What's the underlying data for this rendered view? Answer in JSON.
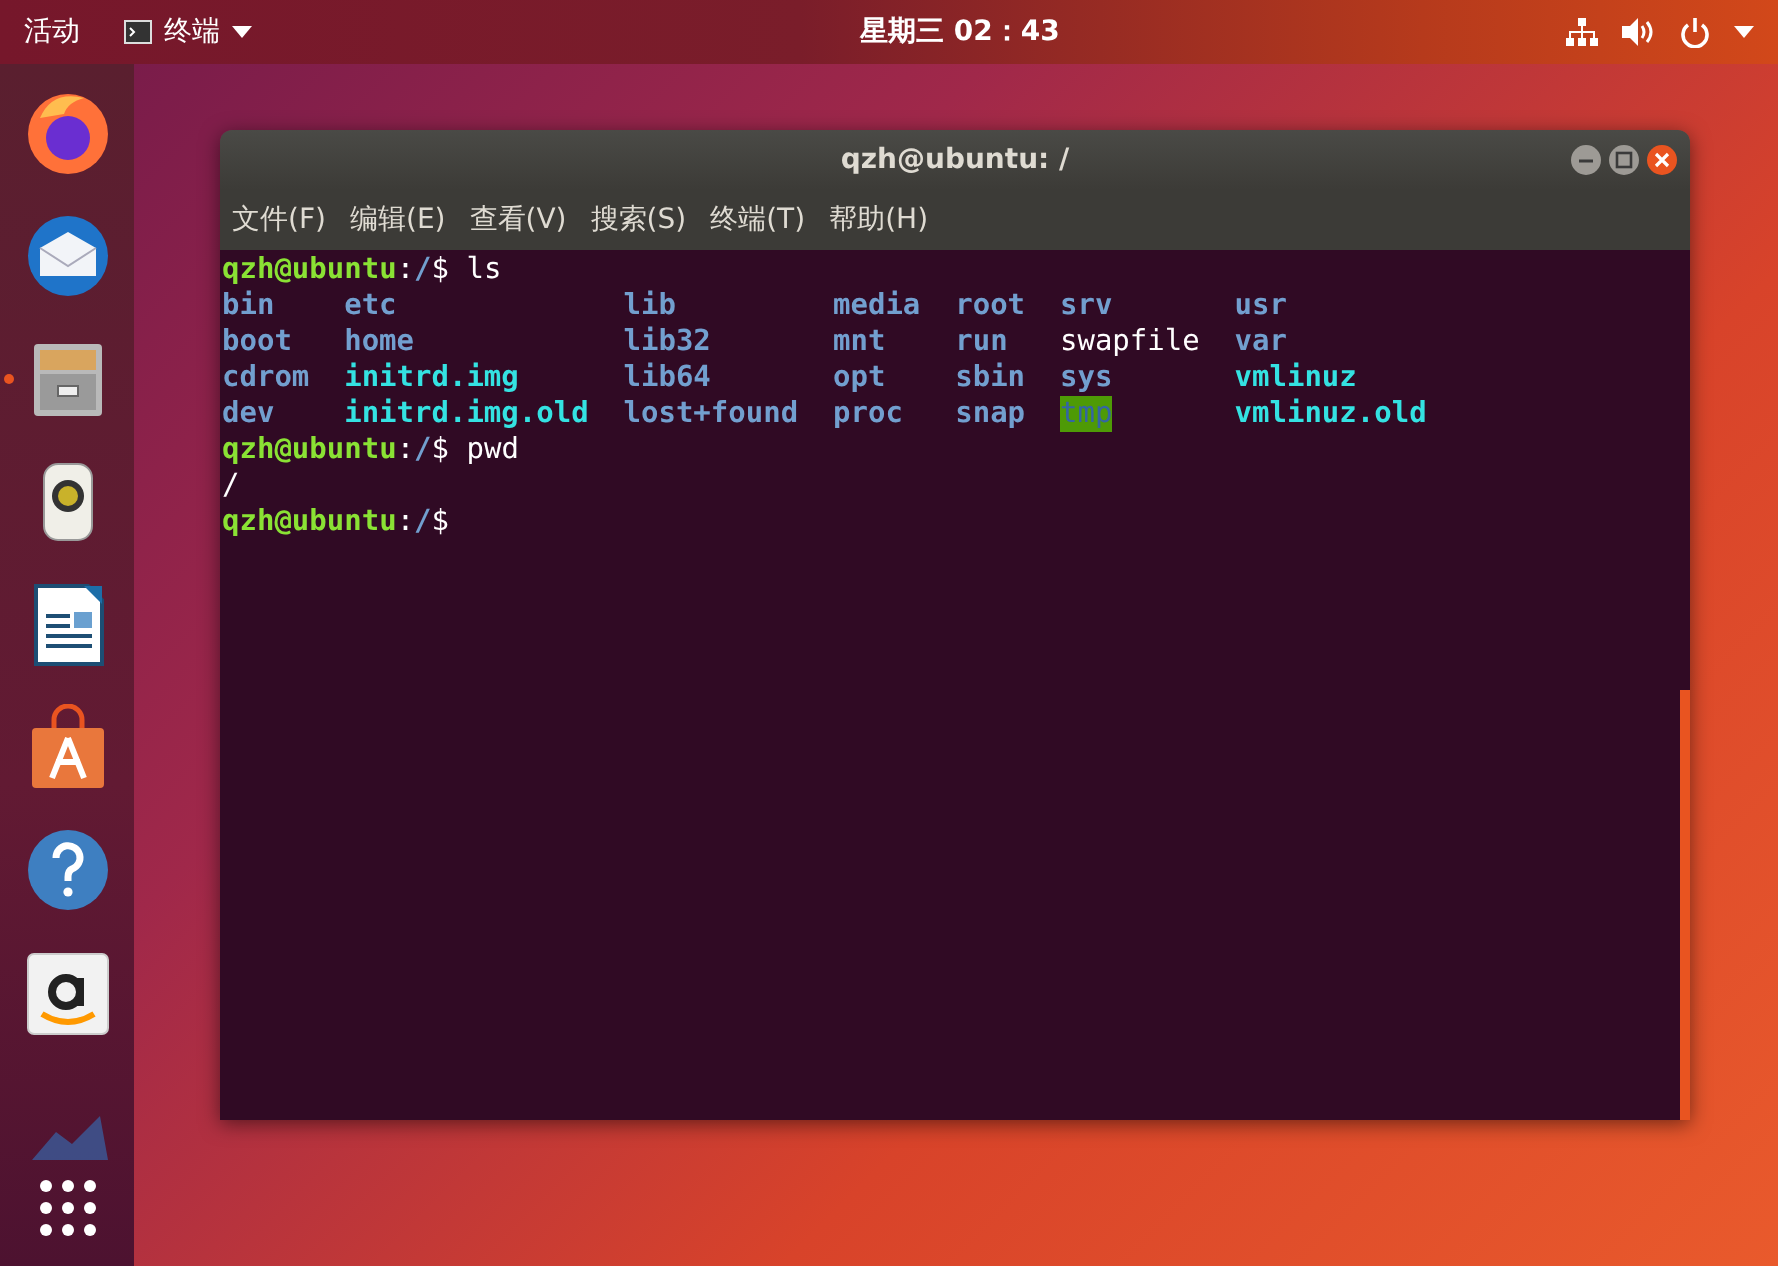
{
  "top_bar": {
    "activities": "活动",
    "app_menu": "终端",
    "clock": "星期三 02：43"
  },
  "dock": {
    "items": [
      {
        "kind": "firefox",
        "running": false
      },
      {
        "kind": "mail",
        "running": false
      },
      {
        "kind": "files",
        "running": true
      },
      {
        "kind": "speaker",
        "running": false
      },
      {
        "kind": "writer",
        "running": false
      },
      {
        "kind": "store",
        "running": false
      },
      {
        "kind": "help",
        "running": false
      },
      {
        "kind": "amazon",
        "running": false
      },
      {
        "kind": "partial",
        "running": false
      }
    ]
  },
  "terminal": {
    "title": "qzh@ubuntu: /",
    "menu": [
      "文件(F)",
      "编辑(E)",
      "查看(V)",
      "搜索(S)",
      "终端(T)",
      "帮助(H)"
    ],
    "lines": [
      {
        "kind": "prompt",
        "user_host": "qzh@ubuntu",
        "colon": ":",
        "path": "/",
        "command": "$ ls"
      },
      {
        "kind": "listing",
        "entries": [
          {
            "text": "bin",
            "kind": "dir"
          },
          {
            "text": "etc",
            "kind": "dir"
          },
          {
            "text": "lib",
            "kind": "dir"
          },
          {
            "text": "media",
            "kind": "dir"
          },
          {
            "text": "root",
            "kind": "dir"
          },
          {
            "text": "srv",
            "kind": "dir"
          },
          {
            "text": "usr",
            "kind": "dir"
          },
          {
            "text": "boot",
            "kind": "dir"
          },
          {
            "text": "home",
            "kind": "dir"
          },
          {
            "text": "lib32",
            "kind": "dir"
          },
          {
            "text": "mnt",
            "kind": "dir"
          },
          {
            "text": "run",
            "kind": "dir"
          },
          {
            "text": "swapfile",
            "kind": "file"
          },
          {
            "text": "var",
            "kind": "dir"
          },
          {
            "text": "cdrom",
            "kind": "dir"
          },
          {
            "text": "initrd.img",
            "kind": "link"
          },
          {
            "text": "lib64",
            "kind": "dir"
          },
          {
            "text": "opt",
            "kind": "dir"
          },
          {
            "text": "sbin",
            "kind": "dir"
          },
          {
            "text": "sys",
            "kind": "dir"
          },
          {
            "text": "vmlinuz",
            "kind": "link"
          },
          {
            "text": "dev",
            "kind": "dir"
          },
          {
            "text": "initrd.img.old",
            "kind": "link"
          },
          {
            "text": "lost+found",
            "kind": "dir"
          },
          {
            "text": "proc",
            "kind": "dir"
          },
          {
            "text": "snap",
            "kind": "dir"
          },
          {
            "text": "tmp",
            "kind": "sticky"
          },
          {
            "text": "vmlinuz.old",
            "kind": "link"
          }
        ]
      },
      {
        "kind": "prompt",
        "user_host": "qzh@ubuntu",
        "colon": ":",
        "path": "/",
        "command": "$ pwd"
      },
      {
        "kind": "output",
        "text": "/"
      },
      {
        "kind": "prompt",
        "user_host": "qzh@ubuntu",
        "colon": ":",
        "path": "/",
        "command": "$"
      }
    ]
  }
}
